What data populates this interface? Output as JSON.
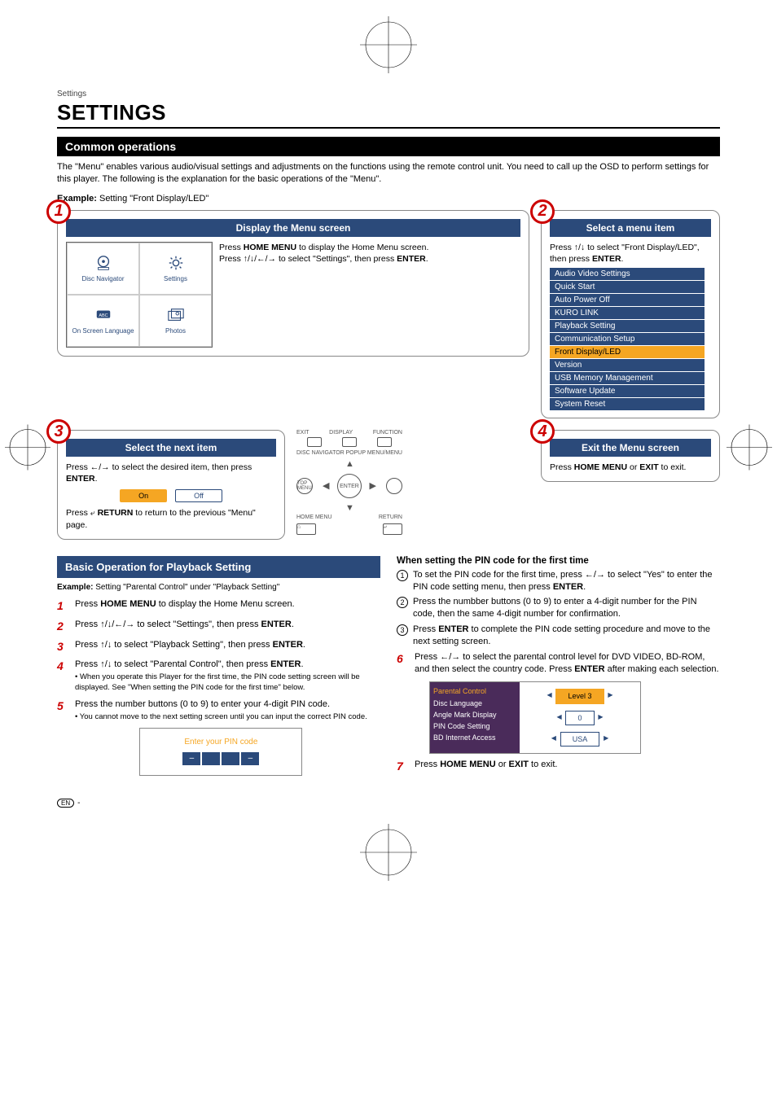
{
  "breadcrumb": "Settings",
  "page_title": "SETTINGS",
  "section1_title": "Common operations",
  "intro": "The \"Menu\" enables various audio/visual settings and adjustments on the functions using the remote control unit. You need to call up the OSD to perform settings for this player. The following is the explanation for the basic operations of the \"Menu\".",
  "example_label": "Example:",
  "example_text": " Setting \"Front Display/LED\"",
  "step1": {
    "num": "1",
    "title": "Display the Menu screen",
    "home_menu": {
      "disc_nav": "Disc Navigator",
      "settings": "Settings",
      "osl": "On Screen Language",
      "osl_badge": "ABC",
      "photos": "Photos"
    },
    "text_a": "Press ",
    "text_b": "HOME MENU",
    "text_c": " to display the Home Menu screen.",
    "text_d": "Press ",
    "text_e": " to select \"Settings\", then press ",
    "text_f": "ENTER",
    "text_g": "."
  },
  "step2": {
    "num": "2",
    "title": "Select a menu item",
    "text_a": "Press ",
    "text_b": " to select \"Front Display/LED\", then press ",
    "text_c": "ENTER",
    "text_d": ".",
    "items": [
      "Audio Video Settings",
      "Quick Start",
      "Auto Power Off",
      "KURO LINK",
      "Playback Setting",
      "Communication Setup",
      "Front Display/LED",
      "Version",
      "USB Memory Management",
      "Software Update",
      "System Reset"
    ],
    "selected_index": 6
  },
  "step3": {
    "num": "3",
    "title": "Select the next item",
    "text_a": "Press ",
    "text_b": " to select the desired item, then press ",
    "text_c": "ENTER",
    "text_d": ".",
    "on": "On",
    "off": "Off",
    "ret_a": "Press ",
    "ret_b": " RETURN",
    "ret_c": " to return to the previous \"Menu\" page."
  },
  "remote": {
    "exit": "EXIT",
    "display": "DISPLAY",
    "function": "FUNCTION",
    "disc_nav": "DISC NAVIGATOR",
    "popup": "POPUP MENU/MENU",
    "top_menu": "TOP MENU",
    "enter": "ENTER",
    "home": "HOME MENU",
    "return": "RETURN"
  },
  "step4": {
    "num": "4",
    "title": "Exit the Menu screen",
    "text_a": "Press ",
    "text_b": "HOME MENU",
    "text_c": " or ",
    "text_d": "EXIT",
    "text_e": " to exit."
  },
  "basic": {
    "title": "Basic Operation for Playback Setting",
    "example_label": "Example:",
    "example_text": " Setting \"Parental Control\" under \"Playback Setting\"",
    "s1_a": "Press ",
    "s1_b": "HOME MENU",
    "s1_c": " to display the Home Menu screen.",
    "s2_a": "Press ",
    "s2_b": " to select \"Settings\", then press ",
    "s2_c": "ENTER",
    "s2_d": ".",
    "s3_a": "Press ",
    "s3_b": " to select \"Playback Setting\", then press ",
    "s3_c": "ENTER",
    "s3_d": ".",
    "s4_a": "Press ",
    "s4_b": " to select \"Parental Control\", then press ",
    "s4_c": "ENTER",
    "s4_d": ".",
    "s4_sub": "When you operate this Player for the first time, the PIN code setting screen will be displayed. See \"When setting the PIN code for the first time\" below.",
    "s5_a": "Press the number buttons (0 to 9) to enter your 4-digit PIN code.",
    "s5_sub": "You cannot move to the next setting screen until you can input the correct PIN code.",
    "pin_title": "Enter your PIN code",
    "pin_cells": [
      "–",
      "",
      "",
      "–"
    ]
  },
  "pinfirst": {
    "heading": "When setting the PIN code for the first time",
    "c1_a": "To set the PIN code for the first time, press ",
    "c1_b": " to select \"Yes\" to enter the PIN code setting menu, then press ",
    "c1_c": "ENTER",
    "c1_d": ".",
    "c2": "Press the numbber buttons (0 to 9) to enter a 4-digit number for the PIN code, then the same 4-digit number for confirmation.",
    "c3_a": "Press ",
    "c3_b": "ENTER",
    "c3_c": " to complete the PIN code setting procedure and move to the next setting screen.",
    "s6_a": "Press ",
    "s6_b": " to select the parental control level for DVD VIDEO, BD-ROM, and then select the country code. Press ",
    "s6_c": "ENTER",
    "s6_d": " after making each selection.",
    "pm_items": [
      "Parental Control",
      "Disc Language",
      "Angle Mark Display",
      "PIN Code Setting",
      "BD Internet Access"
    ],
    "level": "Level 3",
    "zero": "0",
    "usa": "USA",
    "s7_a": "Press ",
    "s7_b": "HOME MENU",
    "s7_c": " or ",
    "s7_d": "EXIT",
    "s7_e": " to exit."
  },
  "footer_en": "EN"
}
